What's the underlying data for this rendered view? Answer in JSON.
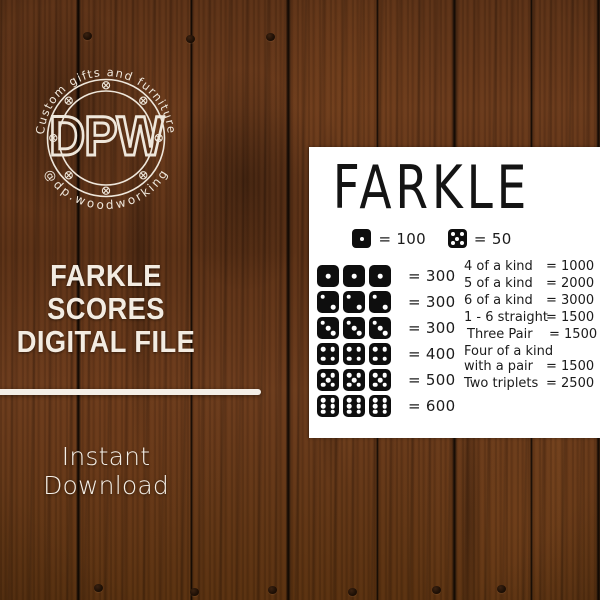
{
  "background": {
    "material": "dark-stained wood planks",
    "base_color": "#5f3317",
    "seam_color": "#120800"
  },
  "left_panel": {
    "logo": {
      "monogram": "DPW",
      "top_arc_text": "Custom gifts and furniture",
      "bottom_arc_text": "@dp.woodworking",
      "color": "#f2ebe0",
      "screw_count": 8
    },
    "headline_line1": "FARKLE SCORES",
    "headline_line2": "DIGITAL FILE",
    "divider_color": "#f4efe7",
    "subtext": "Instant Download",
    "text_color": "#f3ece2"
  },
  "card": {
    "background": "#ffffff",
    "title": "FARKLE",
    "legend": [
      {
        "name": "single-one-die",
        "pips": 1,
        "value": "= 100"
      },
      {
        "name": "single-five-die",
        "pips": 5,
        "value": "= 50"
      }
    ],
    "dice_rows": [
      {
        "name": "three-ones",
        "pips": 1,
        "count": 3,
        "value": "= 300"
      },
      {
        "name": "three-twos",
        "pips": 2,
        "count": 3,
        "value": "= 300"
      },
      {
        "name": "three-threes",
        "pips": 3,
        "count": 3,
        "value": "= 300"
      },
      {
        "name": "three-fours",
        "pips": 4,
        "count": 3,
        "value": "= 400"
      },
      {
        "name": "three-fives",
        "pips": 5,
        "count": 3,
        "value": "= 500"
      },
      {
        "name": "three-sixes",
        "pips": 6,
        "count": 3,
        "value": "= 600"
      }
    ],
    "score_rows": [
      {
        "label": "4 of a kind",
        "value": "= 1000",
        "lines": 1
      },
      {
        "label": "5 of a kind",
        "value": "= 2000",
        "lines": 1
      },
      {
        "label": "6 of a kind",
        "value": "= 3000",
        "lines": 1
      },
      {
        "label": "1 - 6 straight",
        "value": "= 1500",
        "lines": 1
      },
      {
        "label": "Three Pair",
        "value": "= 1500",
        "lines": 1
      },
      {
        "label_line1": "Four of a kind",
        "label_line2": "with a pair",
        "value": "= 1500",
        "lines": 2
      },
      {
        "label": "Two triplets",
        "value": "= 2500",
        "lines": 1
      }
    ]
  }
}
